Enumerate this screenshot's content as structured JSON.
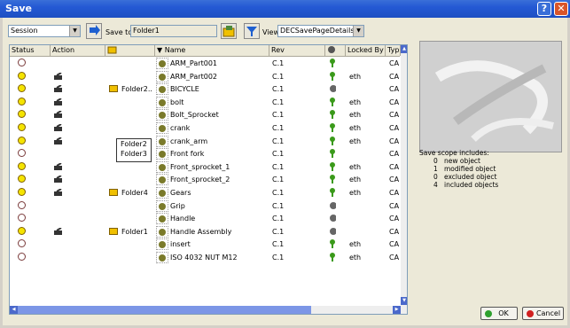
{
  "window": {
    "title": "Save"
  },
  "toolbar": {
    "scope_select": "Session",
    "save_to_label": "Save to",
    "save_to_value": "Folder1",
    "view_label": "View",
    "view_select": "DECSavePageDetails"
  },
  "columns": [
    "Status",
    "Action",
    "",
    "Name",
    "Rev",
    "",
    "Locked By",
    "Typ"
  ],
  "rows": [
    {
      "status": "empty",
      "action": false,
      "folder": "",
      "name": "ARM_Part001",
      "rev": "C.1",
      "lock": "green",
      "locked_by": "",
      "type": "CA"
    },
    {
      "status": "yellow",
      "action": true,
      "folder": "",
      "name": "ARM_Part002",
      "rev": "C.1",
      "lock": "green",
      "locked_by": "eth",
      "type": "CA"
    },
    {
      "status": "yellow",
      "action": true,
      "folder": "Folder2..",
      "name": "BICYCLE",
      "rev": "C.1",
      "lock": "gray",
      "locked_by": "",
      "type": "CA"
    },
    {
      "status": "yellow",
      "action": true,
      "folder": "",
      "name": "bolt",
      "rev": "C.1",
      "lock": "green",
      "locked_by": "eth",
      "type": "CA"
    },
    {
      "status": "yellow",
      "action": true,
      "folder": "",
      "name": "Bolt_Sprocket",
      "rev": "C.1",
      "lock": "green",
      "locked_by": "eth",
      "type": "CA"
    },
    {
      "status": "yellow",
      "action": true,
      "folder": "",
      "name": "crank",
      "rev": "C.1",
      "lock": "green",
      "locked_by": "eth",
      "type": "CA"
    },
    {
      "status": "yellow",
      "action": true,
      "folder": "",
      "name": "crank_arm",
      "rev": "C.1",
      "lock": "green",
      "locked_by": "eth",
      "type": "CA"
    },
    {
      "status": "empty",
      "action": false,
      "folder": "",
      "name": "Front fork",
      "rev": "C.1",
      "lock": "green",
      "locked_by": "",
      "type": "CA"
    },
    {
      "status": "yellow",
      "action": true,
      "folder": "",
      "name": "Front_sprocket_1",
      "rev": "C.1",
      "lock": "green",
      "locked_by": "eth",
      "type": "CA"
    },
    {
      "status": "yellow",
      "action": true,
      "folder": "",
      "name": "Front_sprocket_2",
      "rev": "C.1",
      "lock": "green",
      "locked_by": "eth",
      "type": "CA"
    },
    {
      "status": "yellow",
      "action": true,
      "folder": "Folder4",
      "name": "Gears",
      "rev": "C.1",
      "lock": "green",
      "locked_by": "eth",
      "type": "CA"
    },
    {
      "status": "empty",
      "action": false,
      "folder": "",
      "name": "Grip",
      "rev": "C.1",
      "lock": "gray",
      "locked_by": "",
      "type": "CA"
    },
    {
      "status": "empty",
      "action": false,
      "folder": "",
      "name": "Handle",
      "rev": "C.1",
      "lock": "gray",
      "locked_by": "",
      "type": "CA"
    },
    {
      "status": "yellow",
      "action": true,
      "folder": "Folder1",
      "name": "Handle Assembly",
      "rev": "C.1",
      "lock": "gray",
      "locked_by": "",
      "type": "CA"
    },
    {
      "status": "empty",
      "action": false,
      "folder": "",
      "name": "insert",
      "rev": "C.1",
      "lock": "green",
      "locked_by": "eth",
      "type": "CA"
    },
    {
      "status": "empty",
      "action": false,
      "folder": "",
      "name": "ISO 4032 NUT M12",
      "rev": "C.1",
      "lock": "green",
      "locked_by": "eth",
      "type": "CA"
    }
  ],
  "folder_popup": [
    "Folder2",
    "Folder3"
  ],
  "scope": {
    "title": "Save scope includes:",
    "lines": [
      {
        "count": "0",
        "label": "new object"
      },
      {
        "count": "1",
        "label": "modified object"
      },
      {
        "count": "0",
        "label": "excluded object"
      },
      {
        "count": "4",
        "label": "included objects"
      }
    ]
  },
  "buttons": {
    "ok": "OK",
    "cancel": "Cancel"
  },
  "colors": {
    "title_bar": "#2459d4",
    "status_yellow": "#f5e400",
    "lock_green": "#3a9a1a"
  }
}
